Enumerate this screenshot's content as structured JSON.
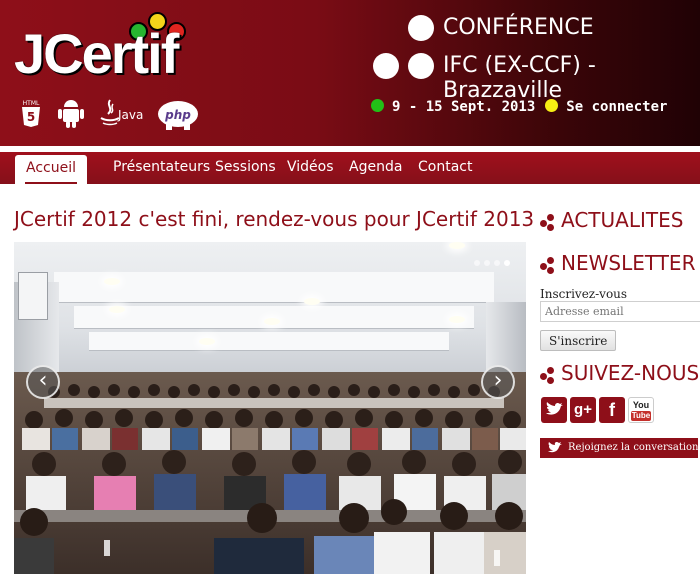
{
  "brand": {
    "name": "JCertif"
  },
  "tech_icons": [
    "html5-icon",
    "android-icon",
    "java-icon",
    "php-icon"
  ],
  "tech_labels": {
    "html5": "HTML",
    "html5_number": "5",
    "java": "Java",
    "php": "php"
  },
  "conference": {
    "title": "CONFÉRENCE",
    "location": "IFC (EX-CCF) - Brazzaville",
    "dates": "9 - 15 Sept. 2013",
    "login": "Se connecter"
  },
  "nav": {
    "items": [
      {
        "label": "Accueil",
        "active": true
      },
      {
        "label": "Présentateurs"
      },
      {
        "label": "Sessions"
      },
      {
        "label": "Vidéos"
      },
      {
        "label": "Agenda"
      },
      {
        "label": "Contact"
      }
    ]
  },
  "main": {
    "title": "JCertif 2012 c'est fini, rendez-vous pour JCertif 2013",
    "slider": {
      "slides": 4,
      "current": 4,
      "prev": "‹",
      "next": "›"
    }
  },
  "sidebar": {
    "news_heading": "ACTUALITES",
    "newsletter_heading": "NEWSLETTER",
    "subscribe_label": "Inscrivez-vous",
    "email_placeholder": "Adresse email",
    "subscribe_button": "S'inscrire",
    "follow_heading": "SUIVEZ-NOUS",
    "social": [
      "twitter-icon",
      "google-plus-icon",
      "facebook-icon",
      "youtube-icon"
    ],
    "social_labels": {
      "google_plus": "g+",
      "facebook": "f",
      "youtube_top": "You",
      "youtube_bottom": "Tube"
    },
    "twitter_cta": "Rejoignez la conversation"
  },
  "colors": {
    "brand_red": "#8e0f19",
    "dot_green": "#22c017",
    "dot_yellow": "#f6ee14",
    "dot_red": "#e0251f"
  }
}
